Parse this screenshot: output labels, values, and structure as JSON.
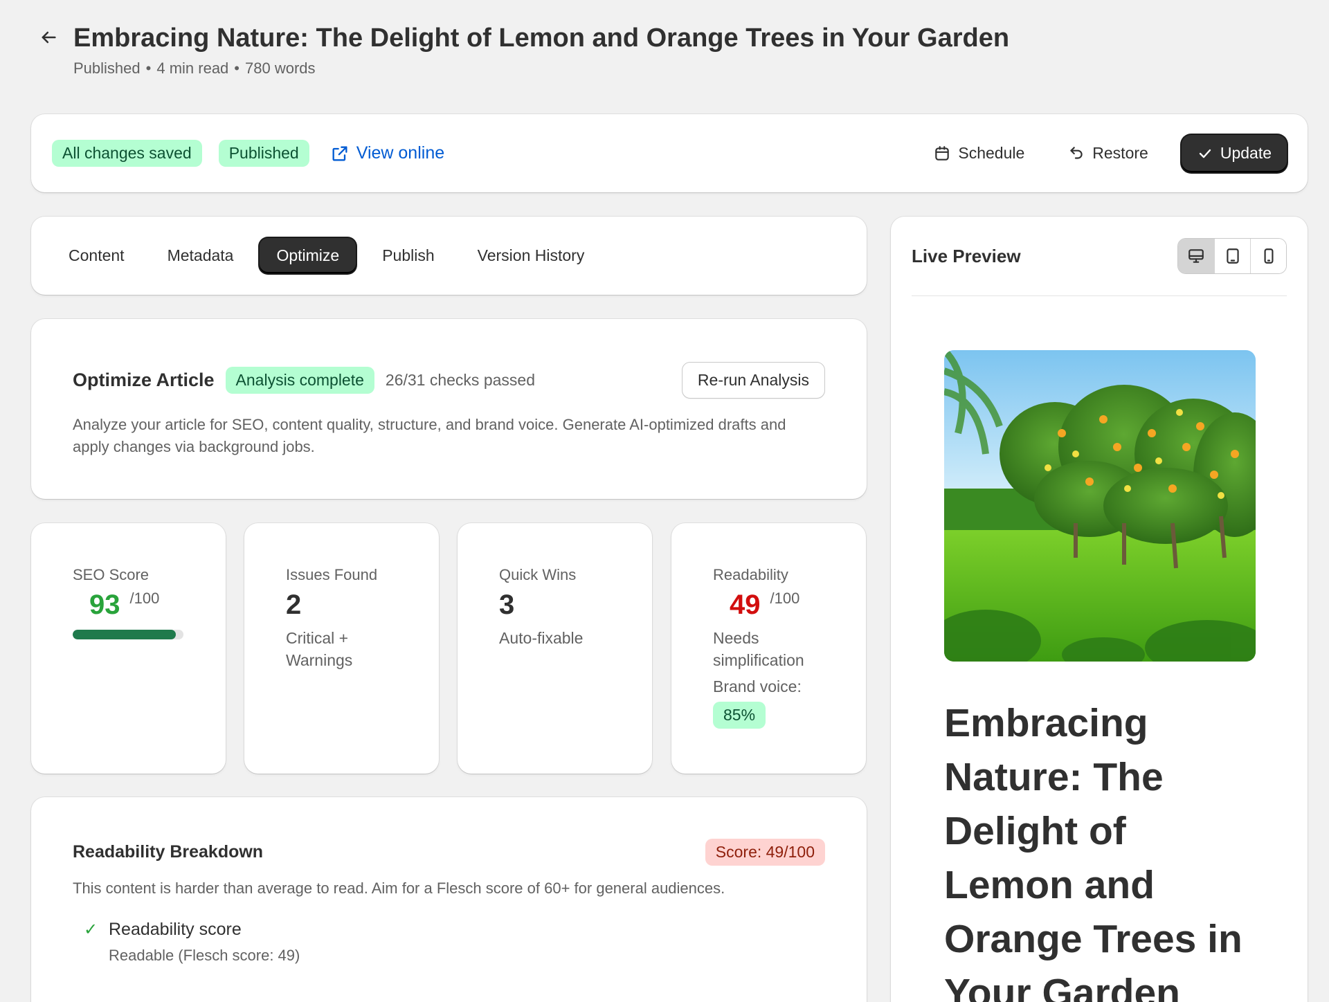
{
  "header": {
    "title": "Embracing Nature: The Delight of Lemon and Orange Trees in Your Garden",
    "meta": [
      "Published",
      "4 min read",
      "780 words"
    ]
  },
  "status_bar": {
    "saved_badge": "All changes saved",
    "published_badge": "Published",
    "view_online": "View online",
    "schedule": "Schedule",
    "restore": "Restore",
    "update": "Update"
  },
  "tabs": [
    "Content",
    "Metadata",
    "Optimize",
    "Publish",
    "Version History"
  ],
  "active_tab": "Optimize",
  "optimize": {
    "title": "Optimize Article",
    "status_badge": "Analysis complete",
    "checks": "26/31 checks passed",
    "rerun": "Re-run Analysis",
    "description": "Analyze your article for SEO, content quality, structure, and brand voice. Generate AI-optimized drafts and apply changes via background jobs."
  },
  "stats": {
    "seo": {
      "label": "SEO Score",
      "value": "93",
      "unit": "/100",
      "progress": 0.93
    },
    "issues": {
      "label": "Issues Found",
      "value": "2",
      "sub": "Critical + Warnings"
    },
    "quick_wins": {
      "label": "Quick Wins",
      "value": "3",
      "sub": "Auto-fixable"
    },
    "readability": {
      "label": "Readability",
      "value": "49",
      "unit": "/100",
      "sub": "Needs simplification",
      "brand_label": "Brand voice:",
      "brand_value": "85%"
    }
  },
  "readability_breakdown": {
    "title": "Readability Breakdown",
    "score_badge": "Score: 49/100",
    "description": "This content is harder than average to read. Aim for a Flesch score of 60+ for general audiences.",
    "items": [
      {
        "title": "Readability score",
        "detail": "Readable (Flesch score: 49)"
      }
    ]
  },
  "preview": {
    "title": "Live Preview",
    "devices": [
      "desktop-icon",
      "tablet-icon",
      "mobile-icon"
    ],
    "article_title": "Embracing Nature: The Delight of Lemon and Orange Trees in Your Garden"
  },
  "colors": {
    "accent_link": "#005bd3",
    "success_badge_bg": "#b4fed2",
    "critical_badge_bg": "#fed3d1",
    "seo_green": "#29a33b",
    "readability_red": "#d20e0e",
    "primary_button": "#303030"
  }
}
